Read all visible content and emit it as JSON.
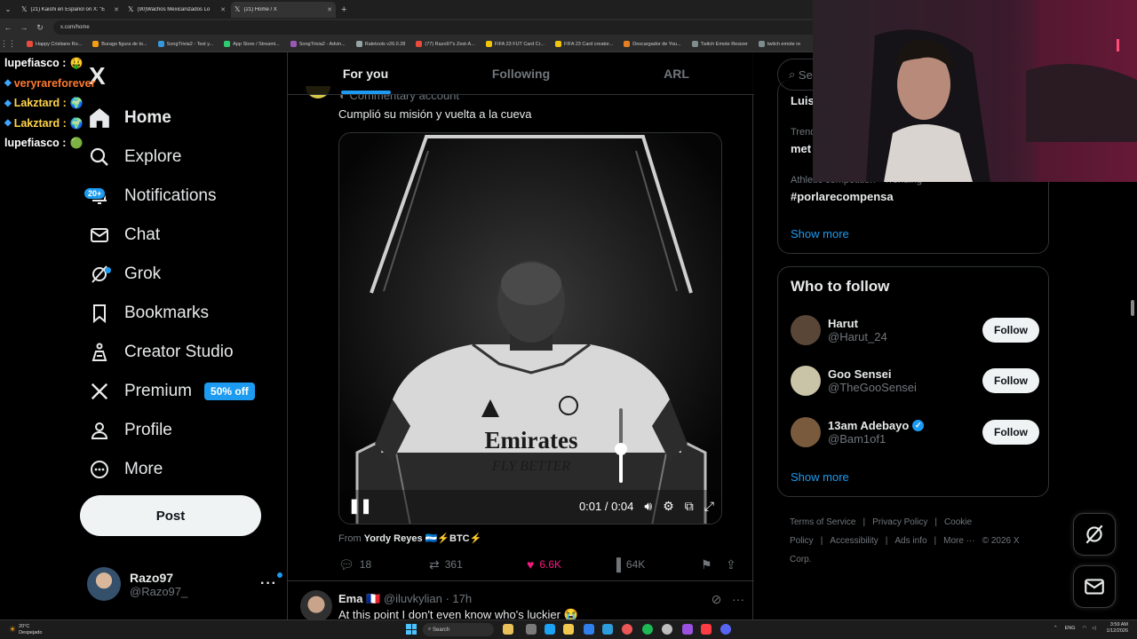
{
  "browser": {
    "tabs": [
      {
        "label": "(21) Kaishi en Español on X: \"E",
        "active": false
      },
      {
        "label": "(90)Wachos Mexicanizados Lo",
        "active": false
      },
      {
        "label": "(21) Home / X",
        "active": true
      }
    ],
    "url": "x.com/home",
    "bookmarks": [
      "Happy Cristiano Ro...",
      "Burago figura de to...",
      "SongTrivia2 - Test y...",
      "App Store / Streami...",
      "SongTrivia2 - Advin...",
      "Raletools v26.0.28",
      "(77) Razo97's Zest-A...",
      "FIFA 23 FUT Card Cr...",
      "FIFA 23 Card creator...",
      "Descargador de You...",
      "Twitch Emote Resizer",
      "twitch emote re"
    ]
  },
  "chat_overlay": [
    {
      "user": "lupefiasco :",
      "color": "#ffffff",
      "emote": "🤑"
    },
    {
      "user": "veryrareforever",
      "color": "#ff7a30",
      "emote": ""
    },
    {
      "user": "Lakztard :",
      "color": "#ffd54a",
      "emote": "🌍"
    },
    {
      "user": "Lakztard :",
      "color": "#ffd54a",
      "emote": "🌍"
    },
    {
      "user": "lupefiasco :",
      "color": "#ffffff",
      "emote": "🟢"
    }
  ],
  "nav": {
    "logo": "X",
    "items": [
      {
        "label": "Home",
        "icon": "home-icon"
      },
      {
        "label": "Explore",
        "icon": "search-icon"
      },
      {
        "label": "Notifications",
        "icon": "bell-icon",
        "badge": "20+"
      },
      {
        "label": "Chat",
        "icon": "mail-icon"
      },
      {
        "label": "Grok",
        "icon": "grok-icon"
      },
      {
        "label": "Bookmarks",
        "icon": "bookmark-icon"
      },
      {
        "label": "Creator Studio",
        "icon": "creator-studio-icon"
      },
      {
        "label": "Premium",
        "icon": "x-icon",
        "badge": "50% off"
      },
      {
        "label": "Profile",
        "icon": "person-icon"
      },
      {
        "label": "More",
        "icon": "more-circle-icon"
      }
    ],
    "post_label": "Post",
    "account": {
      "name": "Razo97",
      "handle": "@Razo97_"
    }
  },
  "feed": {
    "tabs": [
      "For you",
      "Following",
      "ARL"
    ],
    "active_tab": "For you",
    "post": {
      "header": "Commentary account",
      "text": "Cumplió su misión y vuelta a la cueva",
      "video": {
        "elapsed": "0:01",
        "duration": "0:04",
        "progress": 0.25,
        "volume": 0.45
      },
      "from_prefix": "From",
      "from_name": "Yordy Reyes 🇭🇳⚡BTC⚡",
      "replies": "18",
      "reposts": "361",
      "likes": "6.6K",
      "views": "64K"
    },
    "next_post": {
      "name": "Ema 🇫🇷",
      "meta": "@iluvkylian · 17h",
      "text": "At this point I don't even know who's luckier 😭"
    }
  },
  "sidebar": {
    "search_placeholder": "Se",
    "trends": [
      {
        "meta": "",
        "name": "Luis"
      },
      {
        "meta": "Trend",
        "name": "met"
      },
      {
        "meta": "Athletic competition · Trending",
        "name": "#porlarecompensa"
      }
    ],
    "trends_show_more": "Show more",
    "who_to_follow": {
      "title": "Who to follow",
      "users": [
        {
          "name": "Harut",
          "handle": "@Harut_24",
          "verified": false,
          "color": "#5a4636"
        },
        {
          "name": "Goo Sensei",
          "handle": "@TheGooSensei",
          "verified": false,
          "color": "#c9c3a8"
        },
        {
          "name": "13am Adebayo",
          "handle": "@Bam1of1",
          "verified": true,
          "color": "#7a5a3c"
        }
      ],
      "follow_label": "Follow",
      "show_more": "Show more"
    },
    "footer": [
      "Terms of Service",
      "|",
      "Privacy Policy",
      "|",
      "Cookie Policy",
      "|",
      "Accessibility",
      "|",
      "Ads info",
      "|",
      "More ···",
      "© 2026 X Corp."
    ]
  },
  "taskbar": {
    "weather_temp": "20°C",
    "weather_desc": "Despejado",
    "search": "Search",
    "lang": "ENG",
    "time": "3:59 AM",
    "date": "1/12/2026"
  },
  "colors": {
    "accent": "#1d9bf0",
    "like": "#f91880",
    "background": "#000000"
  }
}
